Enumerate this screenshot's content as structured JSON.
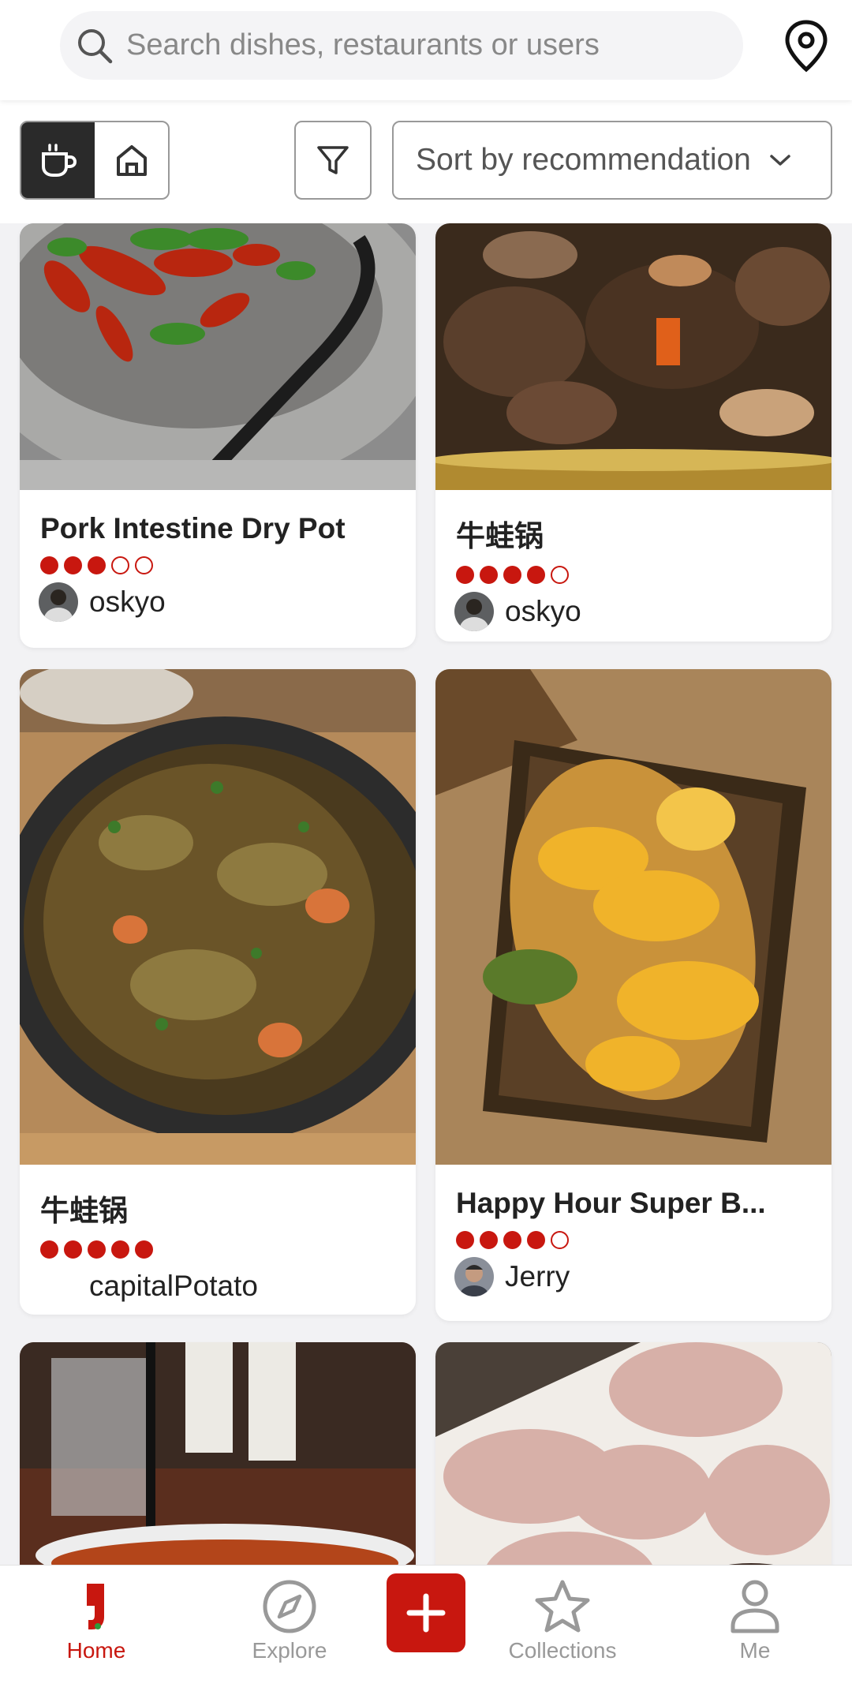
{
  "search": {
    "placeholder": "Search dishes, restaurants or users"
  },
  "icons": {
    "search": "search-icon",
    "location": "location-pin-icon",
    "coffee": "coffee-cup-icon",
    "home": "home-icon",
    "filter": "filter-funnel-icon",
    "chevron": "chevron-down-icon"
  },
  "filters": {
    "sort_label": "Sort by recommendation",
    "active_toggle": "coffee"
  },
  "feed": [
    {
      "title": "Pork Intestine Dry Pot",
      "rating": 3,
      "max_rating": 5,
      "user": "oskyo"
    },
    {
      "title": "牛蛙锅",
      "rating": 4,
      "max_rating": 5,
      "user": "oskyo"
    },
    {
      "title": "牛蛙锅",
      "rating": 5,
      "max_rating": 5,
      "user": "capitalPotato"
    },
    {
      "title": "Happy Hour Super B...",
      "rating": 4,
      "max_rating": 5,
      "user": "Jerry"
    }
  ],
  "nav": {
    "home": "Home",
    "explore": "Explore",
    "collections": "Collections",
    "me": "Me",
    "active": "home"
  },
  "colors": {
    "accent": "#c8170f",
    "toggle_active": "#2a2a2a"
  }
}
